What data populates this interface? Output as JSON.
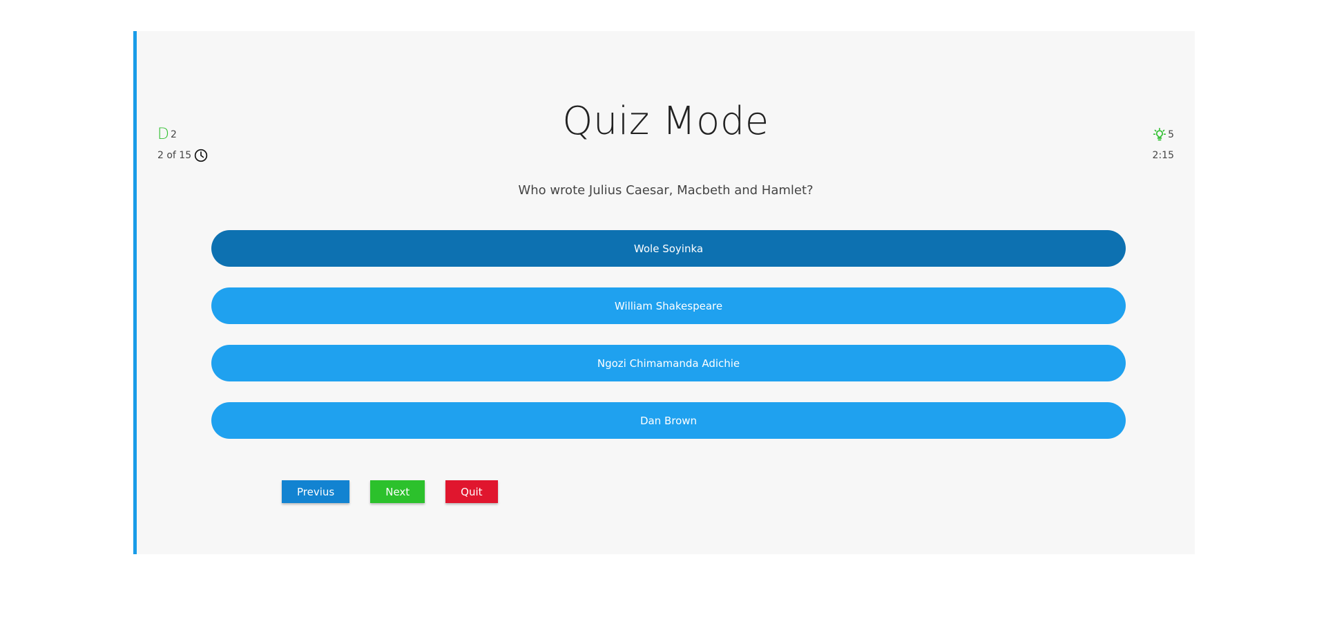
{
  "page": {
    "title": "Quiz Mode"
  },
  "stats": {
    "fifty_fifty_count": "2",
    "progress": "2 of 15",
    "hints_count": "5",
    "timer": "2:15"
  },
  "question": {
    "text": "Who wrote Julius Caesar, Macbeth and Hamlet?"
  },
  "options": [
    {
      "label": "Wole Soyinka",
      "selected": true
    },
    {
      "label": "William Shakespeare",
      "selected": false
    },
    {
      "label": "Ngozi Chimamanda Adichie",
      "selected": false
    },
    {
      "label": "Dan Brown",
      "selected": false
    }
  ],
  "controls": {
    "previous_label": "Previus",
    "next_label": "Next",
    "quit_label": "Quit"
  },
  "colors": {
    "accent": "#1fa1ef",
    "selected": "#0d71b1",
    "next": "#2cc12c",
    "quit": "#e0162e",
    "previous": "#1283d1",
    "green_icon": "#2fbf2f"
  },
  "icons": {
    "fifty_fifty": "fifty-fifty-icon",
    "clock": "clock-icon",
    "hint": "lightbulb-icon"
  }
}
